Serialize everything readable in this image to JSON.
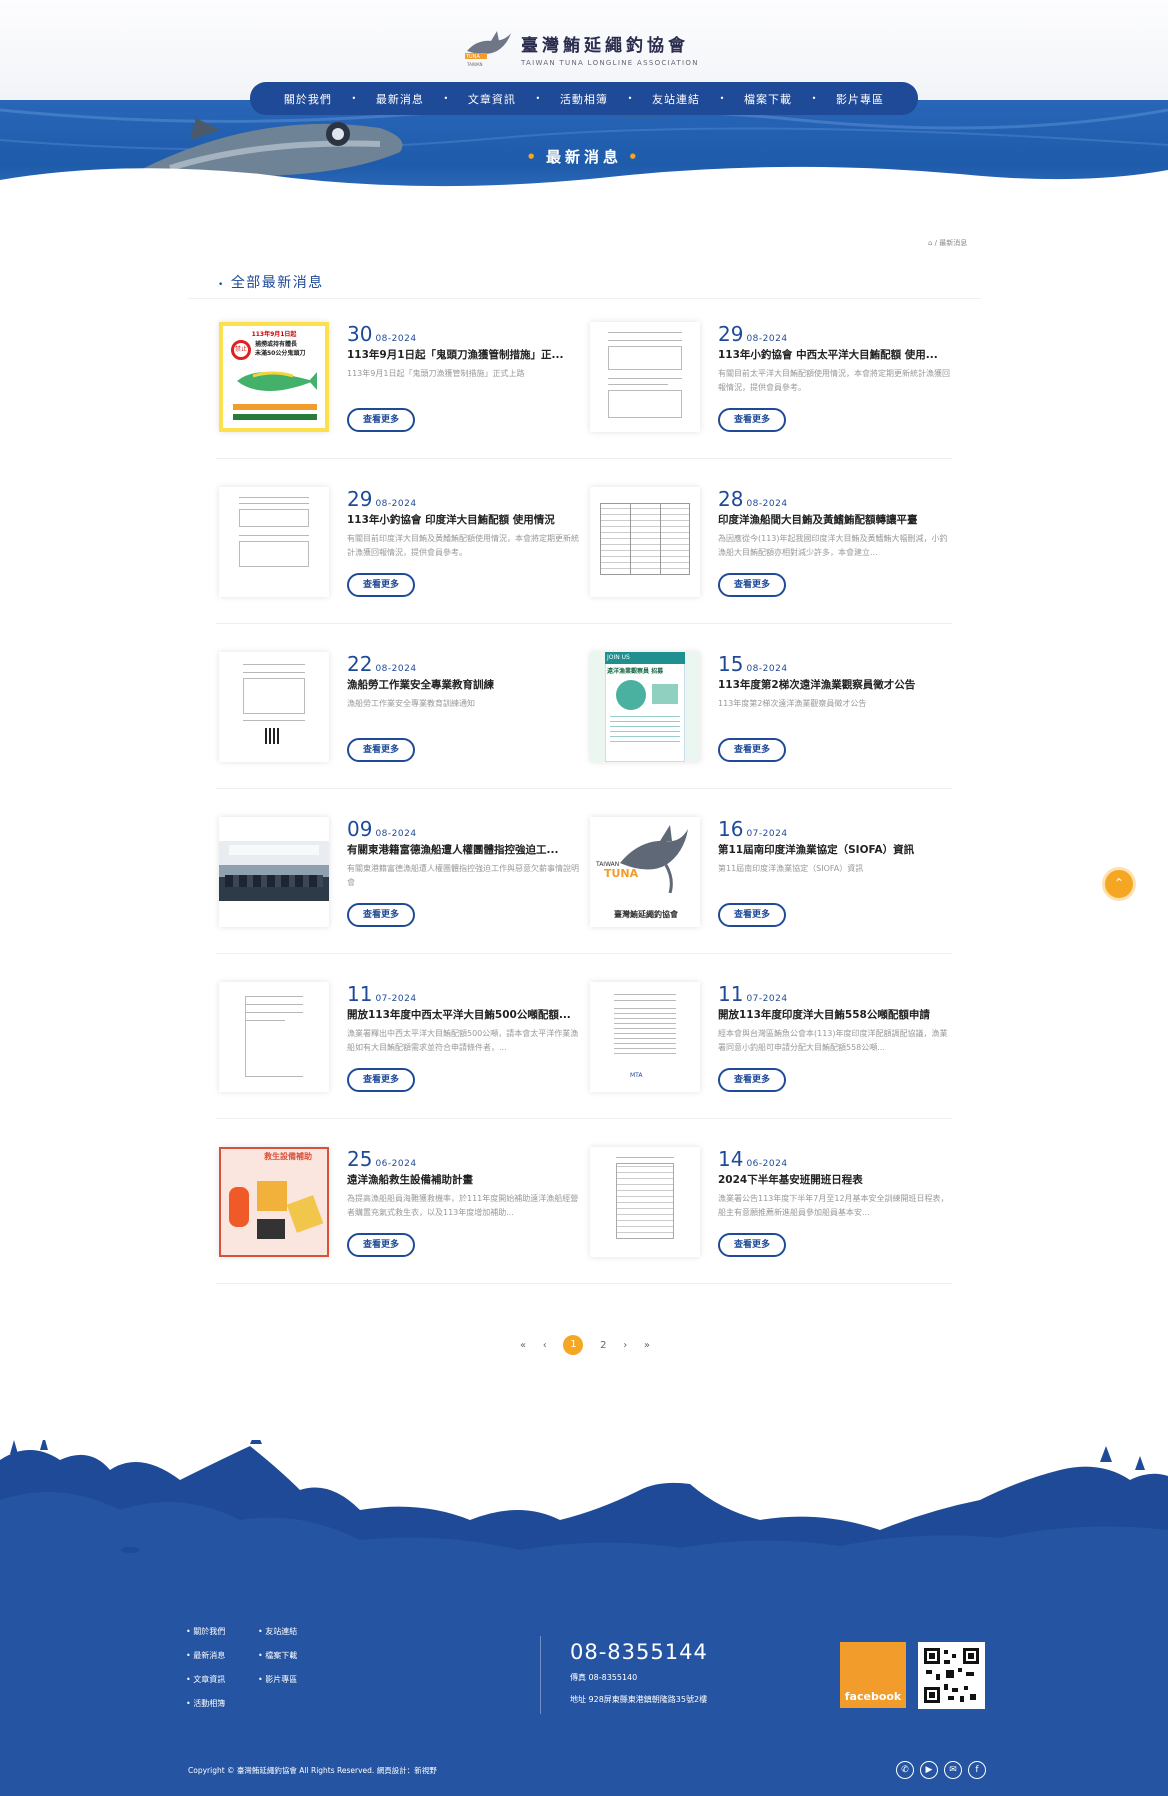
{
  "site": {
    "name_zh": "臺灣鮪延繩釣協會",
    "name_en": "TAIWAN TUNA LONGLINE ASSOCIATION"
  },
  "nav": [
    "關於我們",
    "最新消息",
    "文章資訊",
    "活動相簿",
    "友站連結",
    "檔案下載",
    "影片專區"
  ],
  "hero": {
    "title": "最新消息"
  },
  "breadcrumb": "⌂ / 最新消息",
  "section_title": "全部最新消息",
  "more_label": "查看更多",
  "news": [
    {
      "day": "30",
      "month": "08-2024",
      "title": "113年9月1日起「鬼頭刀漁獲管制措施」正...",
      "excerpt": "113年9月1日起「鬼頭刀漁獲管制措施」正式上路"
    },
    {
      "day": "29",
      "month": "08-2024",
      "title": "113年小釣協會 中西太平洋大目鮪配額 使用...",
      "excerpt": "有關目前太平洋大目鮪配額使用情況，本會將定期更新統計漁獲回報情況，提供會員參考。"
    },
    {
      "day": "29",
      "month": "08-2024",
      "title": "113年小釣協會 印度洋大目鮪配額 使用情況",
      "excerpt": "有關目前印度洋大目鮪及黃鰭鮪配額使用情況，本會將定期更新統計漁獲回報情況，提供會員參考。"
    },
    {
      "day": "28",
      "month": "08-2024",
      "title": "印度洋漁船間大目鮪及黃鰭鮪配額轉讓平臺",
      "excerpt": "為因應從今(113)年起我國印度洋大目鮪及黃鰭鮪大幅刪減，小釣漁船大目鮪配額亦相對減少許多，本會建立..."
    },
    {
      "day": "22",
      "month": "08-2024",
      "title": "漁船勞工作業安全專業教育訓練",
      "excerpt": "漁船勞工作業安全專業教育訓練通知"
    },
    {
      "day": "15",
      "month": "08-2024",
      "title": "113年度第2梯次遠洋漁業觀察員徵才公告",
      "excerpt": "113年度第2梯次遠洋漁業觀察員徵才公告"
    },
    {
      "day": "09",
      "month": "08-2024",
      "title": "有關東港籍富德漁船遭人權團體指控強迫工...",
      "excerpt": "有關東港籍富德漁船遭人權團體指控強迫工作與惡意欠薪事情說明會"
    },
    {
      "day": "16",
      "month": "07-2024",
      "title": "第11屆南印度洋漁業協定（SIOFA）資訊",
      "excerpt": "第11屆南印度洋漁業協定（SIOFA）資訊"
    },
    {
      "day": "11",
      "month": "07-2024",
      "title": "開放113年度中西太平洋大目鮪500公噸配額...",
      "excerpt": "漁業署釋出中西太平洋大目鮪配額500公噸，請本會太平洋作業漁船如有大目鮪配額需求並符合申請條件者，..."
    },
    {
      "day": "11",
      "month": "07-2024",
      "title": "開放113年度印度洋大目鮪558公噸配額申請",
      "excerpt": "經本會與台灣區鮪魚公會本(113)年度印度洋配額調配協議，漁業署同意小釣船可申請分配大目鮪配額558公噸..."
    },
    {
      "day": "25",
      "month": "06-2024",
      "title": "遠洋漁船救生設備補助計畫",
      "excerpt": "為提高漁船船員海難獲救機率，於111年度開始補助遠洋漁船經營者購置充氣式救生衣，以及113年度增加補助..."
    },
    {
      "day": "14",
      "month": "06-2024",
      "title": "2024下半年基安班開班日程表",
      "excerpt": "漁業署公告113年度下半年7月至12月基本安全訓練開班日程表，船主有意願推薦新進船員參加船員基本安..."
    }
  ],
  "thumbs": {
    "t1_head": "113年9月1日起",
    "t1_lines": [
      "禁止",
      "捕撈或持有體長",
      "未滿50公分鬼頭刀"
    ],
    "t6_head": "JOIN US",
    "t6_sub": "遠洋漁業觀察員 招募",
    "t11_head": "救生設備補助",
    "t8_brand": "TAIWAN TUNA LONGLINE ASSOCIATION",
    "t8_zh": "臺灣鮪延繩釣協會"
  },
  "pagination": {
    "first": "«",
    "prev": "‹",
    "pages": [
      "1",
      "2"
    ],
    "current": "1",
    "next": "›",
    "last": "»"
  },
  "footer": {
    "links_col1": [
      "關於我們",
      "最新消息",
      "文章資訊",
      "活動相簿"
    ],
    "links_col2": [
      "友站連結",
      "檔案下載",
      "影片專區"
    ],
    "phone": "08-8355144",
    "fax": "傳真 08-8355140",
    "address": "地址 928屏東縣東港鎮朝隆路35號2樓",
    "facebook": "facebook",
    "copyright": "Copyright © 臺灣鮪延繩釣協會 All Rights Reserved. 網頁設計：新視野"
  },
  "colors": {
    "primary": "#1f4a97",
    "accent": "#f5a623"
  },
  "icons": [
    "phone-icon",
    "youtube-icon",
    "mail-icon",
    "facebook-icon",
    "home-icon",
    "chevron-up-icon"
  ]
}
